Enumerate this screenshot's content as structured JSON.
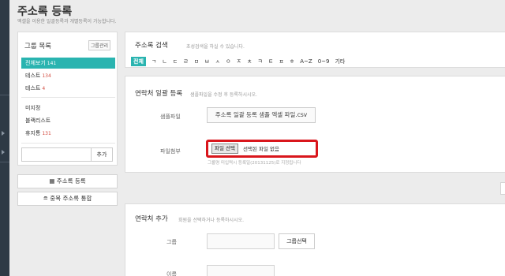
{
  "page": {
    "title": "주소록 등록",
    "subtitle": "엑셀을 이용한 일괄등록과 개별등록이 가능합니다."
  },
  "group_panel": {
    "title": "그룹 목록",
    "manage_label": "그룹관리",
    "items": [
      {
        "label": "전체보기",
        "count": "141",
        "active": true
      },
      {
        "label": "테스트",
        "count": "134",
        "active": false
      },
      {
        "label": "테스트",
        "count": "4",
        "active": false
      },
      {
        "label": "미지정",
        "count": "",
        "active": false
      },
      {
        "label": "블랙리스트",
        "count": "",
        "active": false
      },
      {
        "label": "휴지통",
        "count": "131",
        "active": false
      }
    ],
    "add_label": "추가"
  },
  "side_buttons": {
    "register_label": "주소록 등록",
    "merge_label": "중복 주소록 통합"
  },
  "search": {
    "title": "주소록 검색",
    "hint": "초성검색을 하실 수 있습니다.",
    "letters": [
      "전체",
      "ㄱ",
      "ㄴ",
      "ㄷ",
      "ㄹ",
      "ㅁ",
      "ㅂ",
      "ㅅ",
      "ㅇ",
      "ㅈ",
      "ㅊ",
      "ㅋ",
      "ㅌ",
      "ㅍ",
      "ㅎ",
      "A~Z",
      "0~9",
      "기타"
    ]
  },
  "excel_upload": {
    "title": "연락처 일괄 등록",
    "hint": "샘플파일을 수정 후 등록하시시오.",
    "sample_label": "샘플파일",
    "sample_file": "주소록 일괄 등록 샘플 엑셀 파일.csv",
    "attach_label": "파일첨부",
    "choose_button": "파일 선택",
    "no_file_text": "선택된 파일 없음",
    "note": "그룹명 미입력시 등록일(20131125)로 지정됩니다"
  },
  "contact_add": {
    "title": "연락처 추가",
    "hint": "회원을 선택하거나 등록하시시오.",
    "group_label": "그룹",
    "group_button": "그룹선택",
    "name_label": "이름"
  },
  "colors": {
    "accent": "#2ab4b0",
    "highlight_border": "#d9161c",
    "count_red": "#d24a3e",
    "rail": "#2e3a45"
  }
}
